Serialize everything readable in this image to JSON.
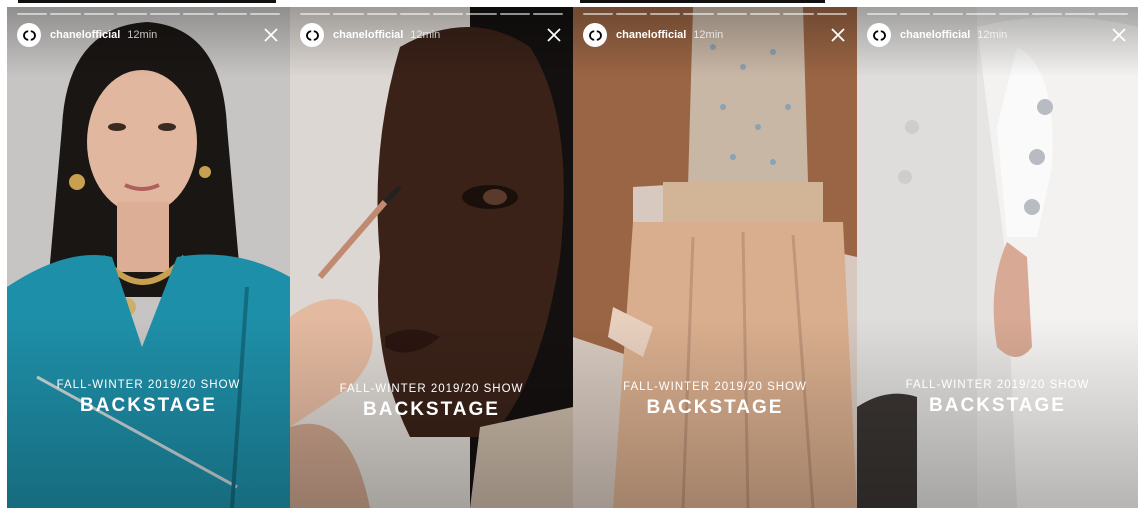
{
  "stories": [
    {
      "username": "chanelofficial",
      "time": "12min",
      "logo_icon": "chanel-cc-logo-icon",
      "close_icon": "close-icon",
      "subtitle": "FALL-WINTER 2019/20 SHOW",
      "title": "BACKSTAGE",
      "bg_colors": [
        "#c9c6c4",
        "#1d8fa6"
      ]
    },
    {
      "username": "chanelofficial",
      "time": "12min",
      "logo_icon": "chanel-cc-logo-icon",
      "close_icon": "close-icon",
      "subtitle": "FALL-WINTER 2019/20 SHOW",
      "title": "BACKSTAGE",
      "bg_colors": [
        "#d9d4cf",
        "#2a1a12"
      ]
    },
    {
      "username": "chanelofficial",
      "time": "12min",
      "logo_icon": "chanel-cc-logo-icon",
      "close_icon": "close-icon",
      "subtitle": "FALL-WINTER 2019/20 SHOW",
      "title": "BACKSTAGE",
      "bg_colors": [
        "#9c6a45",
        "#d6ae8c"
      ]
    },
    {
      "username": "chanelofficial",
      "time": "12min",
      "logo_icon": "chanel-cc-logo-icon",
      "close_icon": "close-icon",
      "subtitle": "FALL-WINTER 2019/20 SHOW",
      "title": "BACKSTAGE",
      "bg_colors": [
        "#e4e3e1",
        "#f2f1ef"
      ]
    }
  ]
}
